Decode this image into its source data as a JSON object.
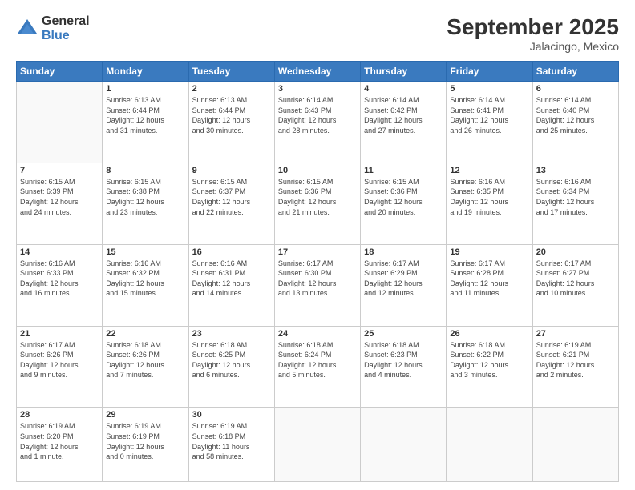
{
  "logo": {
    "general": "General",
    "blue": "Blue"
  },
  "header": {
    "month": "September 2025",
    "location": "Jalacingo, Mexico"
  },
  "weekdays": [
    "Sunday",
    "Monday",
    "Tuesday",
    "Wednesday",
    "Thursday",
    "Friday",
    "Saturday"
  ],
  "weeks": [
    [
      {
        "day": "",
        "info": ""
      },
      {
        "day": "1",
        "info": "Sunrise: 6:13 AM\nSunset: 6:44 PM\nDaylight: 12 hours\nand 31 minutes."
      },
      {
        "day": "2",
        "info": "Sunrise: 6:13 AM\nSunset: 6:44 PM\nDaylight: 12 hours\nand 30 minutes."
      },
      {
        "day": "3",
        "info": "Sunrise: 6:14 AM\nSunset: 6:43 PM\nDaylight: 12 hours\nand 28 minutes."
      },
      {
        "day": "4",
        "info": "Sunrise: 6:14 AM\nSunset: 6:42 PM\nDaylight: 12 hours\nand 27 minutes."
      },
      {
        "day": "5",
        "info": "Sunrise: 6:14 AM\nSunset: 6:41 PM\nDaylight: 12 hours\nand 26 minutes."
      },
      {
        "day": "6",
        "info": "Sunrise: 6:14 AM\nSunset: 6:40 PM\nDaylight: 12 hours\nand 25 minutes."
      }
    ],
    [
      {
        "day": "7",
        "info": "Sunrise: 6:15 AM\nSunset: 6:39 PM\nDaylight: 12 hours\nand 24 minutes."
      },
      {
        "day": "8",
        "info": "Sunrise: 6:15 AM\nSunset: 6:38 PM\nDaylight: 12 hours\nand 23 minutes."
      },
      {
        "day": "9",
        "info": "Sunrise: 6:15 AM\nSunset: 6:37 PM\nDaylight: 12 hours\nand 22 minutes."
      },
      {
        "day": "10",
        "info": "Sunrise: 6:15 AM\nSunset: 6:36 PM\nDaylight: 12 hours\nand 21 minutes."
      },
      {
        "day": "11",
        "info": "Sunrise: 6:15 AM\nSunset: 6:36 PM\nDaylight: 12 hours\nand 20 minutes."
      },
      {
        "day": "12",
        "info": "Sunrise: 6:16 AM\nSunset: 6:35 PM\nDaylight: 12 hours\nand 19 minutes."
      },
      {
        "day": "13",
        "info": "Sunrise: 6:16 AM\nSunset: 6:34 PM\nDaylight: 12 hours\nand 17 minutes."
      }
    ],
    [
      {
        "day": "14",
        "info": "Sunrise: 6:16 AM\nSunset: 6:33 PM\nDaylight: 12 hours\nand 16 minutes."
      },
      {
        "day": "15",
        "info": "Sunrise: 6:16 AM\nSunset: 6:32 PM\nDaylight: 12 hours\nand 15 minutes."
      },
      {
        "day": "16",
        "info": "Sunrise: 6:16 AM\nSunset: 6:31 PM\nDaylight: 12 hours\nand 14 minutes."
      },
      {
        "day": "17",
        "info": "Sunrise: 6:17 AM\nSunset: 6:30 PM\nDaylight: 12 hours\nand 13 minutes."
      },
      {
        "day": "18",
        "info": "Sunrise: 6:17 AM\nSunset: 6:29 PM\nDaylight: 12 hours\nand 12 minutes."
      },
      {
        "day": "19",
        "info": "Sunrise: 6:17 AM\nSunset: 6:28 PM\nDaylight: 12 hours\nand 11 minutes."
      },
      {
        "day": "20",
        "info": "Sunrise: 6:17 AM\nSunset: 6:27 PM\nDaylight: 12 hours\nand 10 minutes."
      }
    ],
    [
      {
        "day": "21",
        "info": "Sunrise: 6:17 AM\nSunset: 6:26 PM\nDaylight: 12 hours\nand 9 minutes."
      },
      {
        "day": "22",
        "info": "Sunrise: 6:18 AM\nSunset: 6:26 PM\nDaylight: 12 hours\nand 7 minutes."
      },
      {
        "day": "23",
        "info": "Sunrise: 6:18 AM\nSunset: 6:25 PM\nDaylight: 12 hours\nand 6 minutes."
      },
      {
        "day": "24",
        "info": "Sunrise: 6:18 AM\nSunset: 6:24 PM\nDaylight: 12 hours\nand 5 minutes."
      },
      {
        "day": "25",
        "info": "Sunrise: 6:18 AM\nSunset: 6:23 PM\nDaylight: 12 hours\nand 4 minutes."
      },
      {
        "day": "26",
        "info": "Sunrise: 6:18 AM\nSunset: 6:22 PM\nDaylight: 12 hours\nand 3 minutes."
      },
      {
        "day": "27",
        "info": "Sunrise: 6:19 AM\nSunset: 6:21 PM\nDaylight: 12 hours\nand 2 minutes."
      }
    ],
    [
      {
        "day": "28",
        "info": "Sunrise: 6:19 AM\nSunset: 6:20 PM\nDaylight: 12 hours\nand 1 minute."
      },
      {
        "day": "29",
        "info": "Sunrise: 6:19 AM\nSunset: 6:19 PM\nDaylight: 12 hours\nand 0 minutes."
      },
      {
        "day": "30",
        "info": "Sunrise: 6:19 AM\nSunset: 6:18 PM\nDaylight: 11 hours\nand 58 minutes."
      },
      {
        "day": "",
        "info": ""
      },
      {
        "day": "",
        "info": ""
      },
      {
        "day": "",
        "info": ""
      },
      {
        "day": "",
        "info": ""
      }
    ]
  ]
}
